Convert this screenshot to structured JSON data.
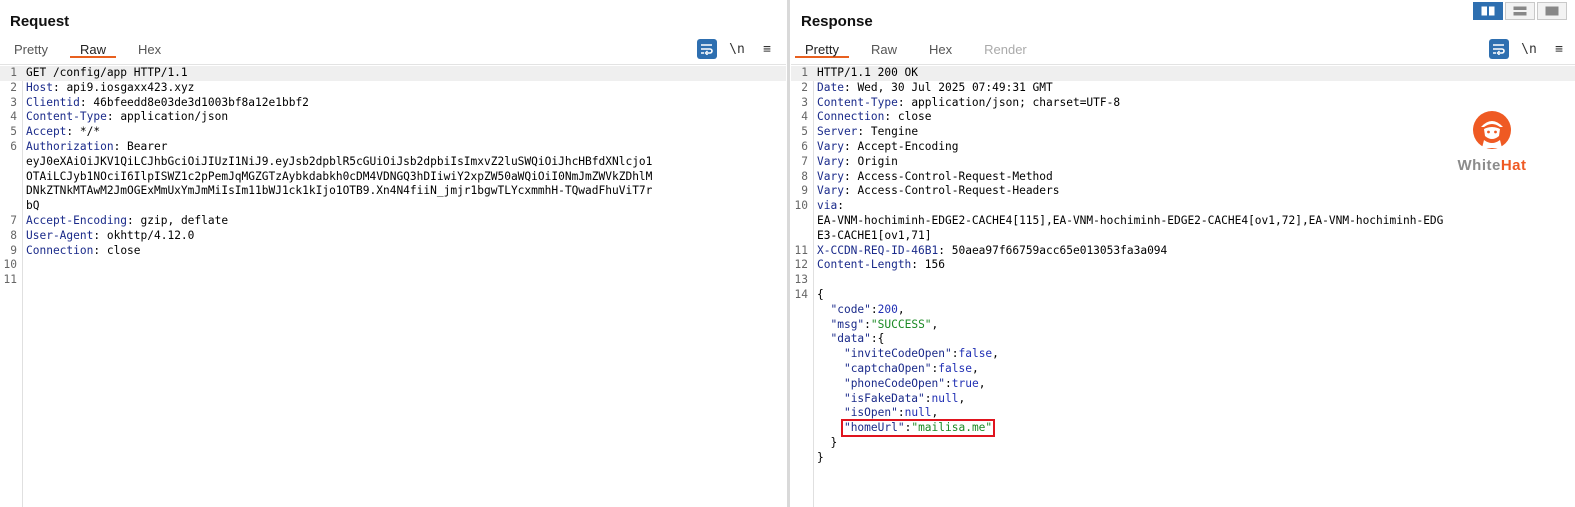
{
  "request": {
    "title": "Request",
    "tabs": [
      {
        "label": "Pretty",
        "active": false
      },
      {
        "label": "Raw",
        "active": true
      },
      {
        "label": "Hex",
        "active": false
      }
    ],
    "tools": {
      "newline_label": "\\n",
      "menu_glyph": "≡"
    },
    "lines": [
      {
        "n": "1",
        "k": "",
        "v": "GET /config/app HTTP/1.1",
        "cur": true
      },
      {
        "n": "2",
        "k": "Host",
        "v": " api9.iosgaxx423.xyz"
      },
      {
        "n": "3",
        "k": "Clientid",
        "v": " 46bfeedd8e03de3d1003bf8a12e1bbf2"
      },
      {
        "n": "4",
        "k": "Content-Type",
        "v": " application/json"
      },
      {
        "n": "5",
        "k": "Accept",
        "v": " */*"
      },
      {
        "n": "6",
        "k": "Authorization",
        "v": " Bearer"
      },
      {
        "n": "",
        "k": "",
        "v": "eyJ0eXAiOiJKV1QiLCJhbGciOiJIUzI1NiJ9.eyJsb2dpblR5cGUiOiJsb2dpbiIsImxvZ2luSWQiOiJhcHBfdXNlcjo1"
      },
      {
        "n": "",
        "k": "",
        "v": "OTAiLCJyb1NOciI6IlpISWZ1c2pPemJqMGZGTzAybkdabkh0cDM4VDNGQ3hDIiwiY2xpZW50aWQiOiI0NmJmZWVkZDhlM"
      },
      {
        "n": "",
        "k": "",
        "v": "DNkZTNkMTAwM2JmOGExMmUxYmJmMiIsIm11bWJ1ck1kIjo1OTB9.Xn4N4fiiN_jmjr1bgwTLYcxmmhH-TQwadFhuViT7r"
      },
      {
        "n": "",
        "k": "",
        "v": "bQ"
      },
      {
        "n": "7",
        "k": "Accept-Encoding",
        "v": " gzip, deflate"
      },
      {
        "n": "8",
        "k": "User-Agent",
        "v": " okhttp/4.12.0"
      },
      {
        "n": "9",
        "k": "Connection",
        "v": " close"
      },
      {
        "n": "10",
        "k": "",
        "v": ""
      },
      {
        "n": "11",
        "k": "",
        "v": ""
      }
    ]
  },
  "response": {
    "title": "Response",
    "tabs": [
      {
        "label": "Pretty",
        "active": true
      },
      {
        "label": "Raw",
        "active": false
      },
      {
        "label": "Hex",
        "active": false
      },
      {
        "label": "Render",
        "active": false,
        "disabled": true
      }
    ],
    "tools": {
      "newline_label": "\\n",
      "menu_glyph": "≡"
    },
    "header_lines": [
      {
        "n": "1",
        "k": "",
        "v": "HTTP/1.1 200 OK",
        "cur": true
      },
      {
        "n": "2",
        "k": "Date",
        "v": " Wed, 30 Jul 2025 07:49:31 GMT"
      },
      {
        "n": "3",
        "k": "Content-Type",
        "v": " application/json; charset=UTF-8"
      },
      {
        "n": "4",
        "k": "Connection",
        "v": " close"
      },
      {
        "n": "5",
        "k": "Server",
        "v": " Tengine"
      },
      {
        "n": "6",
        "k": "Vary",
        "v": " Accept-Encoding"
      },
      {
        "n": "7",
        "k": "Vary",
        "v": " Origin"
      },
      {
        "n": "8",
        "k": "Vary",
        "v": " Access-Control-Request-Method"
      },
      {
        "n": "9",
        "k": "Vary",
        "v": " Access-Control-Request-Headers"
      },
      {
        "n": "10",
        "k": "via",
        "v": ""
      },
      {
        "n": "",
        "k": "",
        "v": "EA-VNM-hochiminh-EDGE2-CACHE4[115],EA-VNM-hochiminh-EDGE2-CACHE4[ov1,72],EA-VNM-hochiminh-EDG"
      },
      {
        "n": "",
        "k": "",
        "v": "E3-CACHE1[ov1,71]"
      },
      {
        "n": "11",
        "k": "X-CCDN-REQ-ID-46B1",
        "v": " 50aea97f66759acc65e013053fa3a094"
      },
      {
        "n": "12",
        "k": "Content-Length",
        "v": " 156"
      },
      {
        "n": "13",
        "k": "",
        "v": ""
      }
    ],
    "body_lines": [
      {
        "n": "14",
        "parts": [
          {
            "c": "",
            "t": "{"
          }
        ]
      },
      {
        "n": "",
        "parts": [
          {
            "c": "",
            "t": "  "
          },
          {
            "c": "jk",
            "t": "\"code\""
          },
          {
            "c": "",
            "t": ":"
          },
          {
            "c": "jn",
            "t": "200"
          },
          {
            "c": "",
            "t": ","
          }
        ]
      },
      {
        "n": "",
        "parts": [
          {
            "c": "",
            "t": "  "
          },
          {
            "c": "jk",
            "t": "\"msg\""
          },
          {
            "c": "",
            "t": ":"
          },
          {
            "c": "js",
            "t": "\"SUCCESS\""
          },
          {
            "c": "",
            "t": ","
          }
        ]
      },
      {
        "n": "",
        "parts": [
          {
            "c": "",
            "t": "  "
          },
          {
            "c": "jk",
            "t": "\"data\""
          },
          {
            "c": "",
            "t": ":{"
          }
        ]
      },
      {
        "n": "",
        "parts": [
          {
            "c": "",
            "t": "    "
          },
          {
            "c": "jk",
            "t": "\"inviteCodeOpen\""
          },
          {
            "c": "",
            "t": ":"
          },
          {
            "c": "jn",
            "t": "false"
          },
          {
            "c": "",
            "t": ","
          }
        ]
      },
      {
        "n": "",
        "parts": [
          {
            "c": "",
            "t": "    "
          },
          {
            "c": "jk",
            "t": "\"captchaOpen\""
          },
          {
            "c": "",
            "t": ":"
          },
          {
            "c": "jn",
            "t": "false"
          },
          {
            "c": "",
            "t": ","
          }
        ]
      },
      {
        "n": "",
        "parts": [
          {
            "c": "",
            "t": "    "
          },
          {
            "c": "jk",
            "t": "\"phoneCodeOpen\""
          },
          {
            "c": "",
            "t": ":"
          },
          {
            "c": "jn",
            "t": "true"
          },
          {
            "c": "",
            "t": ","
          }
        ]
      },
      {
        "n": "",
        "parts": [
          {
            "c": "",
            "t": "    "
          },
          {
            "c": "jk",
            "t": "\"isFakeData\""
          },
          {
            "c": "",
            "t": ":"
          },
          {
            "c": "jn",
            "t": "null"
          },
          {
            "c": "",
            "t": ","
          }
        ]
      },
      {
        "n": "",
        "parts": [
          {
            "c": "",
            "t": "    "
          },
          {
            "c": "jk",
            "t": "\"isOpen\""
          },
          {
            "c": "",
            "t": ":"
          },
          {
            "c": "jn",
            "t": "null"
          },
          {
            "c": "",
            "t": ","
          }
        ]
      },
      {
        "n": "",
        "parts": [
          {
            "c": "",
            "t": "    "
          },
          {
            "c": "jk",
            "t": "\"homeUrl\""
          },
          {
            "c": "",
            "t": ":"
          },
          {
            "c": "js",
            "t": "\"mailisa.me\""
          }
        ],
        "boxed": true
      },
      {
        "n": "",
        "parts": [
          {
            "c": "",
            "t": "  }"
          }
        ]
      },
      {
        "n": "",
        "parts": [
          {
            "c": "",
            "t": "}"
          }
        ]
      }
    ]
  },
  "watermark": {
    "word1": "White",
    "word2": "Hat"
  },
  "colors": {
    "accent": "#e8601f",
    "selected": "#2e6fb0",
    "highlight": "#e0141e"
  }
}
